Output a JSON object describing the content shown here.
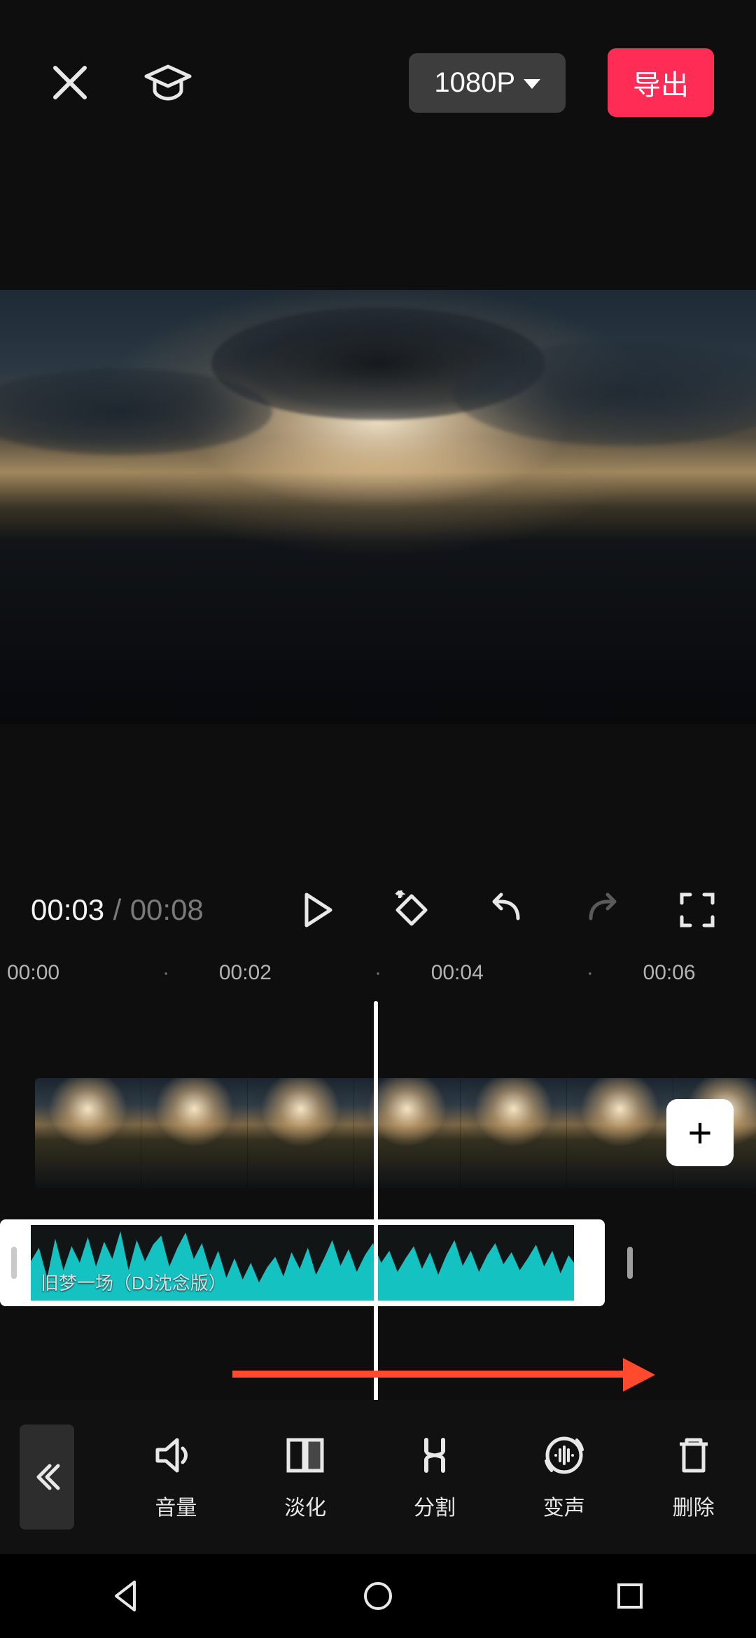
{
  "header": {
    "resolution_label": "1080P",
    "export_label": "导出"
  },
  "playback": {
    "current_time": "00:03",
    "separator": "/",
    "duration": "00:08"
  },
  "ruler": {
    "ticks": [
      "00:00",
      "00:02",
      "00:04",
      "00:06"
    ]
  },
  "audio": {
    "track_name": "旧梦一场（DJ沈念版）"
  },
  "toolbar": {
    "items": [
      {
        "id": "volume",
        "label": "音量"
      },
      {
        "id": "fade",
        "label": "淡化"
      },
      {
        "id": "split",
        "label": "分割"
      },
      {
        "id": "voice",
        "label": "变声"
      },
      {
        "id": "delete",
        "label": "删除"
      }
    ]
  },
  "buttons": {
    "add_clip": "+"
  }
}
